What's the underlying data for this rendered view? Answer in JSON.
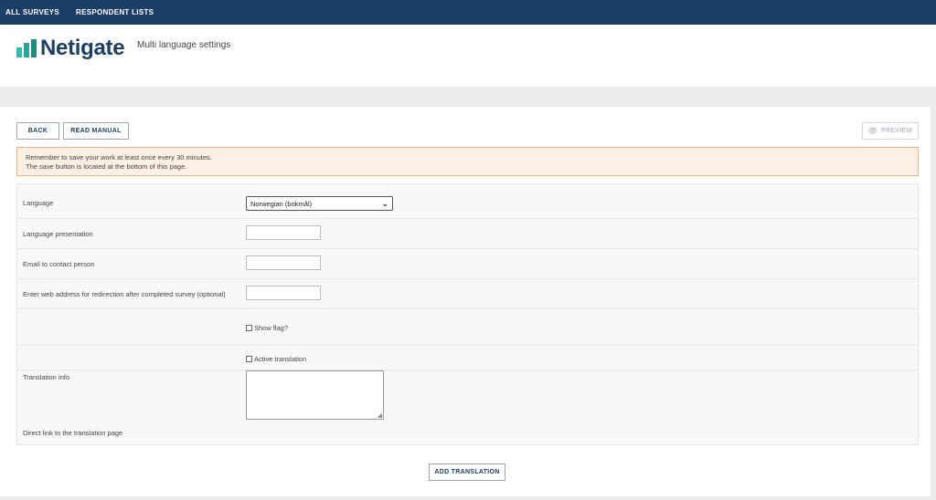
{
  "nav": {
    "items": [
      {
        "label": "ALL SURVEYS"
      },
      {
        "label": "RESPONDENT LISTS"
      }
    ]
  },
  "header": {
    "logo_text": "Netigate",
    "subtitle": "Multi language settings"
  },
  "toolbar": {
    "back_label": "BACK",
    "manual_label": "READ MANUAL",
    "preview_label": "PREVIEW"
  },
  "alert": {
    "line1": "Remember to save your work at least once every 30 minutes.",
    "line2": "The save button is located at the bottom of this page."
  },
  "form": {
    "language_label": "Language",
    "language_value": "Norwegian (bokmål)",
    "presentation_label": "Language presentation",
    "email_label": "Email to contact person",
    "redirect_label": "Enter web address for redirection after completed survey (optional)",
    "show_flag_label": "Show flag?",
    "active_translation_label": "Active translation",
    "translation_info_label": "Translation info",
    "direct_link_label": "Direct link to the translation page"
  },
  "footer": {
    "add_label": "ADD TRANSLATION"
  },
  "colors": {
    "nav_bg": "#1b3f66",
    "brand_teal": "#2bbfae",
    "alert_bg": "#fcefe3",
    "alert_border": "#f0b07a"
  }
}
